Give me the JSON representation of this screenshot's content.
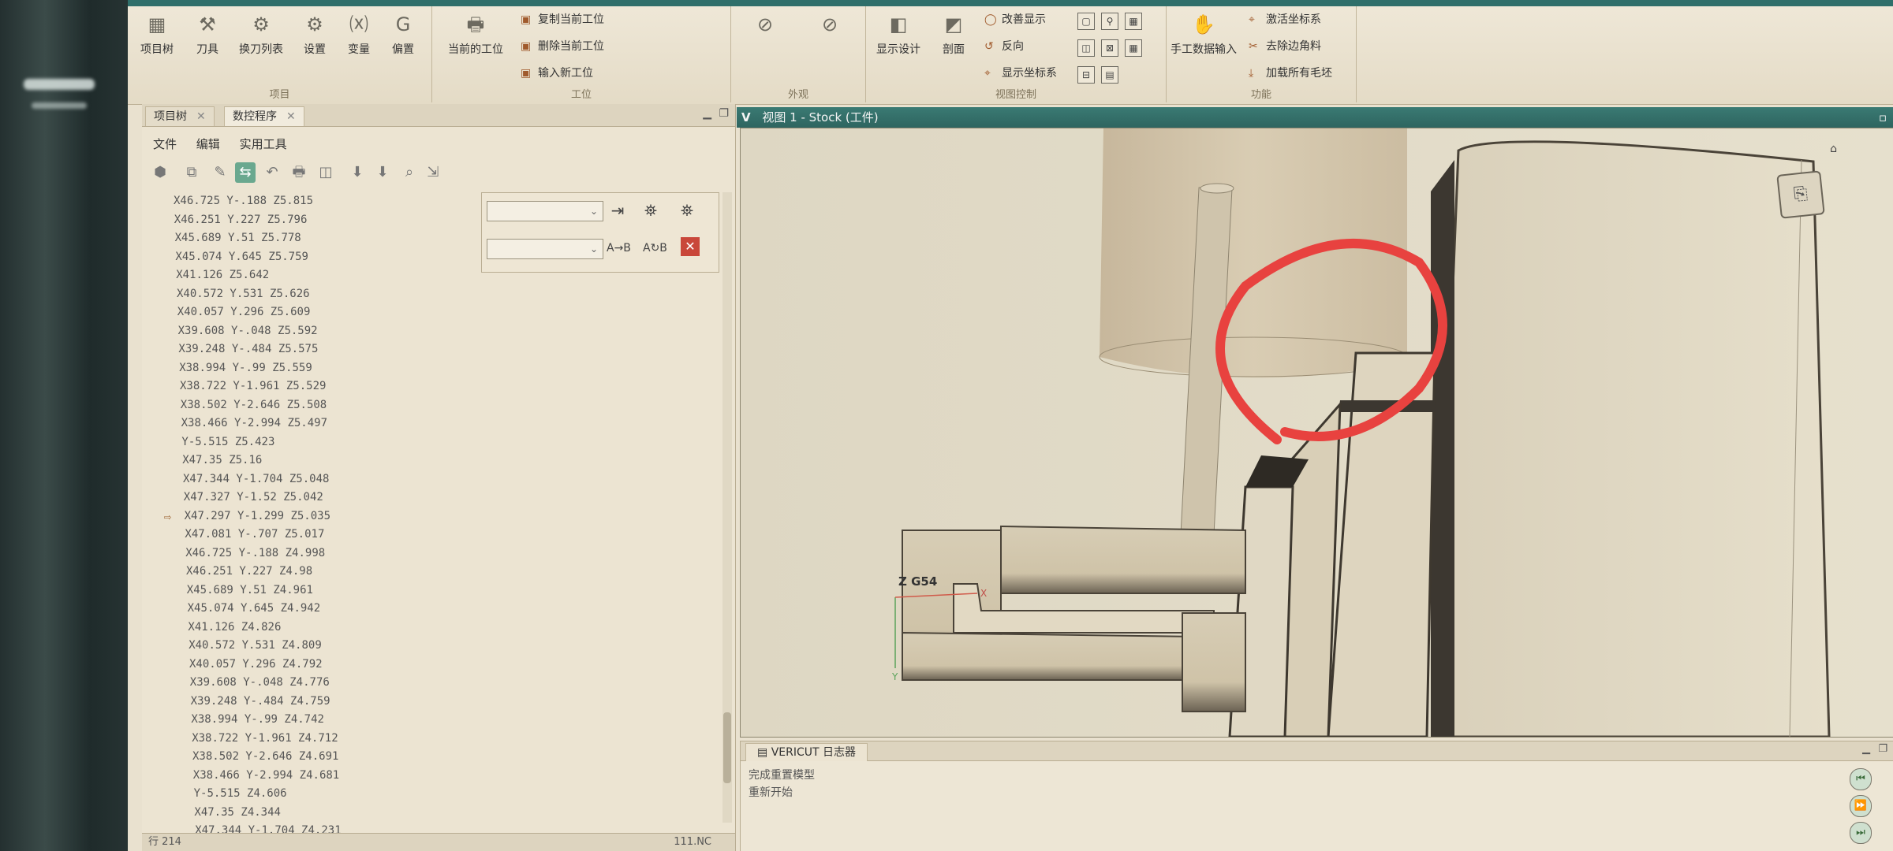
{
  "ribbon": {
    "groups": {
      "project": "项目",
      "setup": "工位",
      "appearance": "外观",
      "view_control": "视图控制",
      "functions": "功能"
    },
    "buttons": {
      "project_tree": "项目树",
      "tools": "刀具",
      "tool_change_list": "换刀列表",
      "settings": "设置",
      "variables": "变量",
      "offsets": "偏置",
      "current_setup": "当前的工位",
      "copy_setup": "复制当前工位",
      "delete_setup": "删除当前工位",
      "add_setup": "输入新工位",
      "show_design": "显示设计",
      "section": "剖面",
      "change_display": "改善显示",
      "reverse": "反向",
      "show_csys": "显示坐标系",
      "manual_data_input": "手工数据输入",
      "active_csys": "激活坐标系",
      "remove_edge": "去除边角料",
      "load_all_blanks": "加载所有毛坯"
    }
  },
  "left_panel": {
    "tabs": [
      "项目树",
      "数控程序"
    ],
    "menu": [
      "文件",
      "编辑",
      "实用工具"
    ],
    "code_lines": [
      "X46.725 Y-.188 Z5.815",
      "X46.251 Y.227 Z5.796",
      "X45.689 Y.51 Z5.778",
      "X45.074 Y.645 Z5.759",
      "X41.126 Z5.642",
      "X40.572 Y.531 Z5.626",
      "X40.057 Y.296 Z5.609",
      "X39.608 Y-.048 Z5.592",
      "X39.248 Y-.484 Z5.575",
      "X38.994 Y-.99 Z5.559",
      "X38.722 Y-1.961 Z5.529",
      "X38.502 Y-2.646 Z5.508",
      "X38.466 Y-2.994 Z5.497",
      "Y-5.515 Z5.423",
      "X47.35 Z5.16",
      "X47.344 Y-1.704 Z5.048",
      "X47.327 Y-1.52 Z5.042",
      "X47.297 Y-1.299 Z5.035",
      "X47.081 Y-.707 Z5.017",
      "X46.725 Y-.188 Z4.998",
      "X46.251 Y.227 Z4.98",
      "X45.689 Y.51 Z4.961",
      "X45.074 Y.645 Z4.942",
      "X41.126 Z4.826",
      "X40.572 Y.531 Z4.809",
      "X40.057 Y.296 Z4.792",
      "X39.608 Y-.048 Z4.776",
      "X39.248 Y-.484 Z4.759",
      "X38.994 Y-.99 Z4.742",
      "X38.722 Y-1.961 Z4.712",
      "X38.502 Y-2.646 Z4.691",
      "X38.466 Y-2.994 Z4.681",
      "Y-5.515 Z4.606",
      "X47.35 Z4.344",
      "X47.344 Y-1.704 Z4.231"
    ],
    "current_line_index": 17,
    "status_left": "行 214",
    "status_right": "111.NC"
  },
  "viewport": {
    "title": "视图 1 - Stock (工件)",
    "coord_system_label": "Z G54",
    "axis_x": "X",
    "axis_y": "Y"
  },
  "log": {
    "tab": "VERICUT 日志器",
    "lines": [
      "完成重置模型",
      "重新开始"
    ]
  }
}
